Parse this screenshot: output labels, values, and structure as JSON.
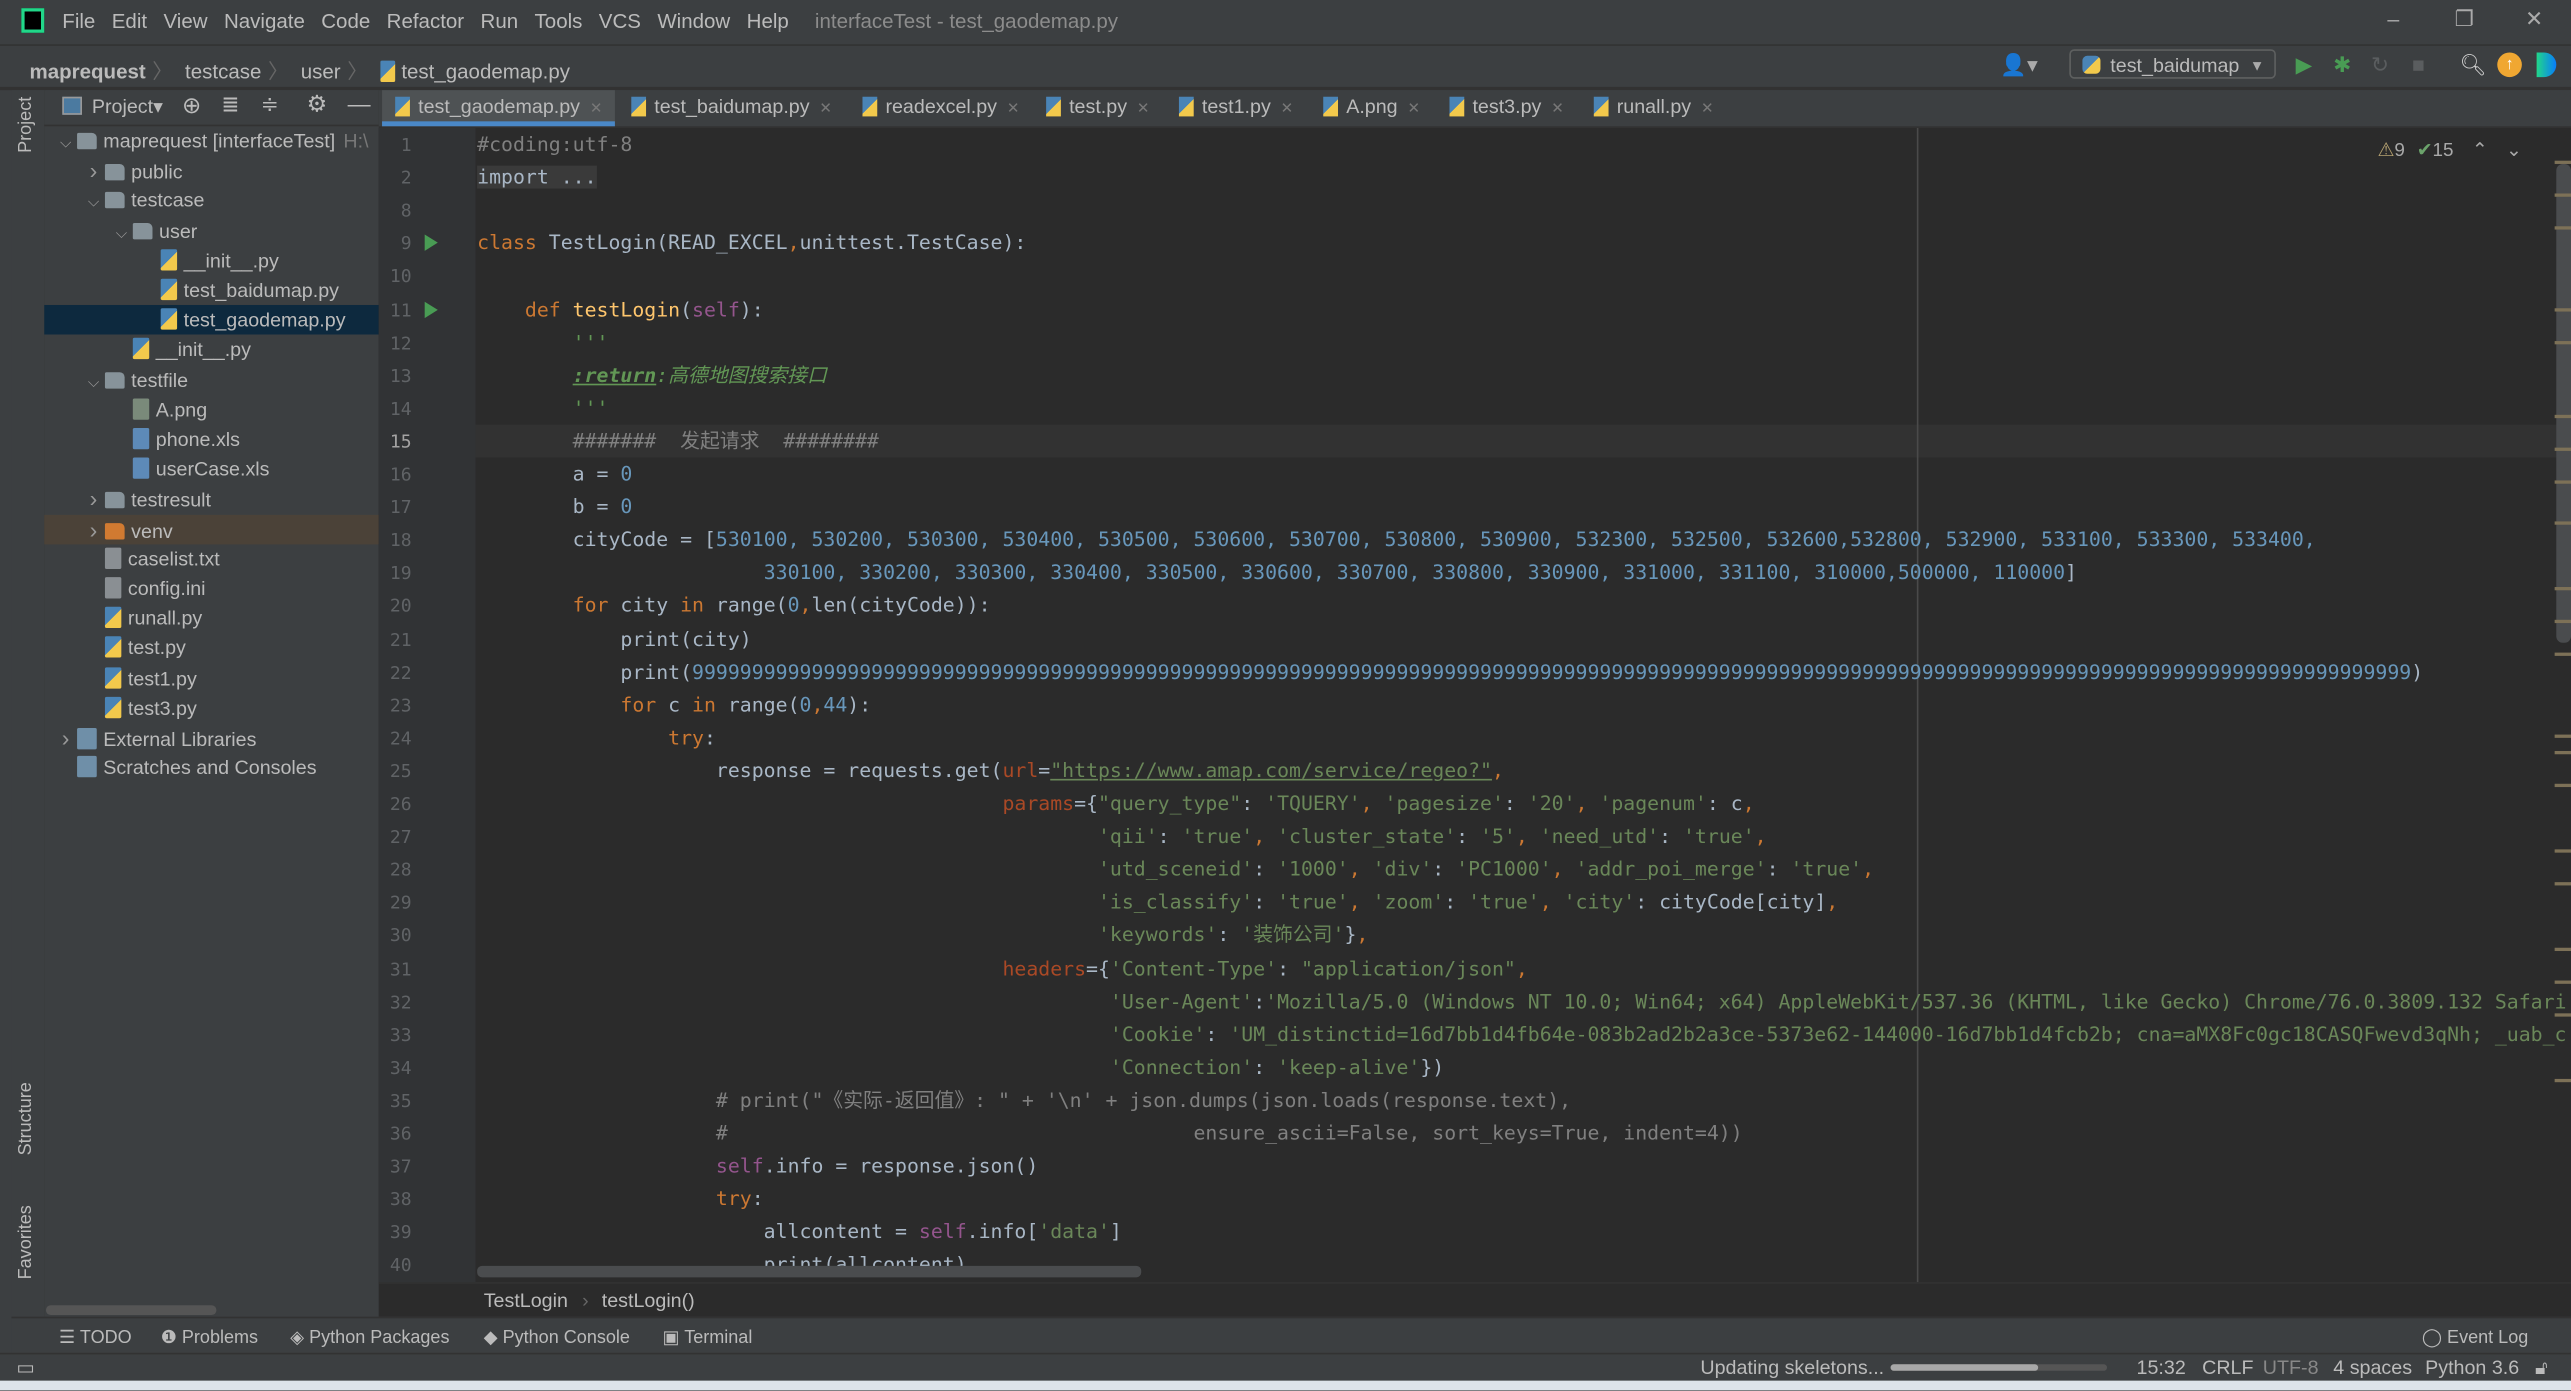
{
  "window": {
    "title": "interfaceTest - test_gaodemap.py",
    "menu": [
      "File",
      "Edit",
      "View",
      "Navigate",
      "Code",
      "Refactor",
      "Run",
      "Tools",
      "VCS",
      "Window",
      "Help"
    ],
    "minimize": "–",
    "restore": "❐",
    "close": "✕"
  },
  "navbar": {
    "crumbs": [
      "maprequest",
      "testcase",
      "user",
      "test_gaodemap.py"
    ],
    "run_config": "test_baidumap"
  },
  "project_panel": {
    "label": "Project",
    "strip_label": "Project",
    "structure_label": "Structure",
    "favorites_label": "Favorites",
    "tree": [
      {
        "label": "maprequest [interfaceTest]",
        "extra": "H:\\",
        "level": 0,
        "arrow": "down",
        "icon": "folder"
      },
      {
        "label": "public",
        "level": 1,
        "arrow": "right",
        "icon": "folder"
      },
      {
        "label": "testcase",
        "level": 1,
        "arrow": "down",
        "icon": "folder"
      },
      {
        "label": "user",
        "level": 2,
        "arrow": "down",
        "icon": "folder"
      },
      {
        "label": "__init__.py",
        "level": 3,
        "icon": "py"
      },
      {
        "label": "test_baidumap.py",
        "level": 3,
        "icon": "py"
      },
      {
        "label": "test_gaodemap.py",
        "level": 3,
        "icon": "py",
        "selected": true
      },
      {
        "label": "__init__.py",
        "level": 2,
        "icon": "py"
      },
      {
        "label": "testfile",
        "level": 1,
        "arrow": "down",
        "icon": "folder"
      },
      {
        "label": "A.png",
        "level": 2,
        "icon": "img"
      },
      {
        "label": "phone.xls",
        "level": 2,
        "icon": "xls"
      },
      {
        "label": "userCase.xls",
        "level": 2,
        "icon": "xls"
      },
      {
        "label": "testresult",
        "level": 1,
        "arrow": "right",
        "icon": "folder"
      },
      {
        "label": "venv",
        "level": 1,
        "arrow": "right",
        "icon": "folder-orange",
        "excluded": true
      },
      {
        "label": "caselist.txt",
        "level": 1,
        "icon": "txt"
      },
      {
        "label": "config.ini",
        "level": 1,
        "icon": "txt"
      },
      {
        "label": "runall.py",
        "level": 1,
        "icon": "py"
      },
      {
        "label": "test.py",
        "level": 1,
        "icon": "py"
      },
      {
        "label": "test1.py",
        "level": 1,
        "icon": "py"
      },
      {
        "label": "test3.py",
        "level": 1,
        "icon": "py"
      },
      {
        "label": "External Libraries",
        "level": 0,
        "arrow": "right",
        "icon": "lib"
      },
      {
        "label": "Scratches and Consoles",
        "level": 0,
        "icon": "lib"
      }
    ]
  },
  "tabs": [
    {
      "label": "test_gaodemap.py",
      "active": true
    },
    {
      "label": "test_baidumap.py"
    },
    {
      "label": "readexcel.py"
    },
    {
      "label": "test.py"
    },
    {
      "label": "test1.py"
    },
    {
      "label": "A.png"
    },
    {
      "label": "test3.py"
    },
    {
      "label": "runall.py"
    }
  ],
  "editor": {
    "warnings": "9",
    "weak_warnings": "15",
    "current_line": "15",
    "lines": [
      {
        "n": "1",
        "t": [
          [
            "c",
            "#coding:utf-8"
          ]
        ]
      },
      {
        "n": "2",
        "t": [
          [
            "fold",
            "import ..."
          ]
        ]
      },
      {
        "n": "8",
        "t": []
      },
      {
        "n": "9",
        "run": true,
        "t": [
          [
            "k",
            "class "
          ],
          [
            "n",
            "TestLogin(READ_EXCEL"
          ],
          [
            "k",
            ","
          ],
          [
            "n",
            "unittest.TestCase):"
          ]
        ]
      },
      {
        "n": "10",
        "t": []
      },
      {
        "n": "11",
        "run": true,
        "t": [
          [
            "n",
            "    "
          ],
          [
            "k",
            "def "
          ],
          [
            "fn",
            "testLogin"
          ],
          [
            "n",
            "("
          ],
          [
            "self",
            "self"
          ],
          [
            "n",
            "):"
          ]
        ]
      },
      {
        "n": "12",
        "t": [
          [
            "n",
            "        "
          ],
          [
            "doc",
            "'''"
          ]
        ]
      },
      {
        "n": "13",
        "t": [
          [
            "n",
            "        "
          ],
          [
            "docb",
            ":return"
          ],
          [
            "doc",
            ":高德地图搜索接口"
          ]
        ]
      },
      {
        "n": "14",
        "t": [
          [
            "n",
            "        "
          ],
          [
            "doc",
            "'''"
          ]
        ]
      },
      {
        "n": "15",
        "t": [
          [
            "n",
            "        "
          ],
          [
            "c",
            "#######  发起请求  ########"
          ]
        ]
      },
      {
        "n": "16",
        "t": [
          [
            "n",
            "        a = "
          ],
          [
            "num",
            "0"
          ]
        ]
      },
      {
        "n": "17",
        "t": [
          [
            "n",
            "        b = "
          ],
          [
            "num",
            "0"
          ]
        ]
      },
      {
        "n": "18",
        "t": [
          [
            "n",
            "        cityCode = ["
          ],
          [
            "list",
            "530100, 530200, 530300, 530400, 530500, 530600, 530700, 530800, 530900, 532300, 532500, 532600,532800, 532900, 533100, 533300, 533400,"
          ]
        ]
      },
      {
        "n": "19",
        "t": [
          [
            "n",
            "                        "
          ],
          [
            "list",
            "330100, 330200, 330300, 330400, 330500, 330600, 330700, 330800, 330900, 331000, 331100, 310000,500000, 110000"
          ],
          [
            "n",
            "]"
          ]
        ]
      },
      {
        "n": "20",
        "t": [
          [
            "n",
            "        "
          ],
          [
            "k",
            "for "
          ],
          [
            "n",
            "city "
          ],
          [
            "k",
            "in "
          ],
          [
            "n",
            "range("
          ],
          [
            "num",
            "0"
          ],
          [
            "k",
            ","
          ],
          [
            "n",
            "len(cityCode)):"
          ]
        ]
      },
      {
        "n": "21",
        "t": [
          [
            "n",
            "            print(city)"
          ]
        ]
      },
      {
        "n": "22",
        "t": [
          [
            "n",
            "            print("
          ],
          [
            "num",
            "999999999999999999999999999999999999999999999999999999999999999999999999999999999999999999999999999999999999999999999999999999999999999999999999"
          ],
          [
            "n",
            ")"
          ]
        ]
      },
      {
        "n": "23",
        "t": [
          [
            "n",
            "            "
          ],
          [
            "k",
            "for "
          ],
          [
            "n",
            "c "
          ],
          [
            "k",
            "in "
          ],
          [
            "n",
            "range("
          ],
          [
            "num",
            "0"
          ],
          [
            "k",
            ","
          ],
          [
            "num",
            "44"
          ],
          [
            "n",
            "):"
          ]
        ]
      },
      {
        "n": "24",
        "t": [
          [
            "n",
            "                "
          ],
          [
            "k",
            "try"
          ],
          [
            "n",
            ":"
          ]
        ]
      },
      {
        "n": "25",
        "t": [
          [
            "n",
            "                    response = requests.get("
          ],
          [
            "kw",
            "url"
          ],
          [
            "n",
            "="
          ],
          [
            "url",
            "\"https://www.amap.com/service/regeo?\""
          ],
          [
            "k",
            ","
          ]
        ]
      },
      {
        "n": "26",
        "t": [
          [
            "n",
            "                                            "
          ],
          [
            "kw",
            "params"
          ],
          [
            "n",
            "={"
          ],
          [
            "s",
            "\"query_type\""
          ],
          [
            "n",
            ": "
          ],
          [
            "s",
            "'TQUERY'"
          ],
          [
            "k",
            ", "
          ],
          [
            "s",
            "'pagesize'"
          ],
          [
            "n",
            ": "
          ],
          [
            "s",
            "'20'"
          ],
          [
            "k",
            ", "
          ],
          [
            "s",
            "'pagenum'"
          ],
          [
            "n",
            ": c"
          ],
          [
            "k",
            ","
          ]
        ]
      },
      {
        "n": "27",
        "t": [
          [
            "n",
            "                                                    "
          ],
          [
            "s",
            "'qii'"
          ],
          [
            "n",
            ": "
          ],
          [
            "s",
            "'true'"
          ],
          [
            "k",
            ", "
          ],
          [
            "s",
            "'cluster_state'"
          ],
          [
            "n",
            ": "
          ],
          [
            "s",
            "'5'"
          ],
          [
            "k",
            ", "
          ],
          [
            "s",
            "'need_utd'"
          ],
          [
            "n",
            ": "
          ],
          [
            "s",
            "'true'"
          ],
          [
            "k",
            ","
          ]
        ]
      },
      {
        "n": "28",
        "t": [
          [
            "n",
            "                                                    "
          ],
          [
            "s",
            "'utd_sceneid'"
          ],
          [
            "n",
            ": "
          ],
          [
            "s",
            "'1000'"
          ],
          [
            "k",
            ", "
          ],
          [
            "s",
            "'div'"
          ],
          [
            "n",
            ": "
          ],
          [
            "s",
            "'PC1000'"
          ],
          [
            "k",
            ", "
          ],
          [
            "s",
            "'addr_poi_merge'"
          ],
          [
            "n",
            ": "
          ],
          [
            "s",
            "'true'"
          ],
          [
            "k",
            ","
          ]
        ]
      },
      {
        "n": "29",
        "t": [
          [
            "n",
            "                                                    "
          ],
          [
            "s",
            "'is_classify'"
          ],
          [
            "n",
            ": "
          ],
          [
            "s",
            "'true'"
          ],
          [
            "k",
            ", "
          ],
          [
            "s",
            "'zoom'"
          ],
          [
            "n",
            ": "
          ],
          [
            "s",
            "'true'"
          ],
          [
            "k",
            ", "
          ],
          [
            "s",
            "'city'"
          ],
          [
            "n",
            ": cityCode[city]"
          ],
          [
            "k",
            ","
          ]
        ]
      },
      {
        "n": "30",
        "t": [
          [
            "n",
            "                                                    "
          ],
          [
            "s",
            "'keywords'"
          ],
          [
            "n",
            ": "
          ],
          [
            "s",
            "'装饰公司'"
          ],
          [
            "n",
            "}"
          ],
          [
            "k",
            ","
          ]
        ]
      },
      {
        "n": "31",
        "t": [
          [
            "n",
            "                                            "
          ],
          [
            "kw",
            "headers"
          ],
          [
            "n",
            "={"
          ],
          [
            "s",
            "'Content-Type'"
          ],
          [
            "n",
            ": "
          ],
          [
            "s",
            "\"application/json\""
          ],
          [
            "k",
            ","
          ]
        ]
      },
      {
        "n": "32",
        "t": [
          [
            "n",
            "                                                     "
          ],
          [
            "s",
            "'User-Agent'"
          ],
          [
            "n",
            ":"
          ],
          [
            "s",
            "'Mozilla/5.0 (Windows NT 10.0; Win64; x64) AppleWebKit/537.36 (KHTML, like Gecko) Chrome/76.0.3809.132 Safari"
          ]
        ]
      },
      {
        "n": "33",
        "t": [
          [
            "n",
            "                                                     "
          ],
          [
            "s",
            "'Cookie'"
          ],
          [
            "n",
            ": "
          ],
          [
            "s",
            "'UM_distinctid=16d7bb1d4fb64e-083b2ad2b2a3ce-5373e62-144000-16d7bb1d4fcb2b; cna=aMX8Fc0gc18CASQFwevd3qNh; _uab_c"
          ]
        ]
      },
      {
        "n": "34",
        "t": [
          [
            "n",
            "                                                     "
          ],
          [
            "s",
            "'Connection'"
          ],
          [
            "n",
            ": "
          ],
          [
            "s",
            "'keep-alive'"
          ],
          [
            "n",
            "})"
          ]
        ]
      },
      {
        "n": "35",
        "t": [
          [
            "n",
            "                    "
          ],
          [
            "c",
            "# print(\"《实际-返回值》: \" + '\\n' + json.dumps(json.loads(response.text),"
          ]
        ]
      },
      {
        "n": "36",
        "t": [
          [
            "n",
            "                    "
          ],
          [
            "c",
            "#                                       ensure_ascii=False, sort_keys=True, indent=4))"
          ]
        ]
      },
      {
        "n": "37",
        "t": [
          [
            "n",
            "                    "
          ],
          [
            "self",
            "self"
          ],
          [
            "n",
            ".info = response.json()"
          ]
        ]
      },
      {
        "n": "38",
        "t": [
          [
            "n",
            "                    "
          ],
          [
            "k",
            "try"
          ],
          [
            "n",
            ":"
          ]
        ]
      },
      {
        "n": "39",
        "t": [
          [
            "n",
            "                        allcontent = "
          ],
          [
            "self",
            "self"
          ],
          [
            "n",
            ".info["
          ],
          [
            "s",
            "'data'"
          ],
          [
            "n",
            "]"
          ]
        ]
      },
      {
        "n": "40",
        "t": [
          [
            "n",
            "                        print(allcontent)"
          ]
        ]
      }
    ]
  },
  "editor_breadcrumb": [
    "TestLogin",
    "testLogin()"
  ],
  "tool_windows": [
    "TODO",
    "Problems",
    "Python Packages",
    "Python Console",
    "Terminal"
  ],
  "event_log": "Event Log",
  "status": {
    "task": "Updating skeletons...",
    "progress": 0.68,
    "position": "15:32",
    "line_sep": "CRLF",
    "encoding": "UTF-8",
    "indent": "4 spaces",
    "interpreter": "Python 3.6"
  },
  "colors": {
    "accent": "#4a88c7",
    "keyword": "#cc7832",
    "string": "#6a8759",
    "number": "#6897bb",
    "run": "#499c54"
  }
}
